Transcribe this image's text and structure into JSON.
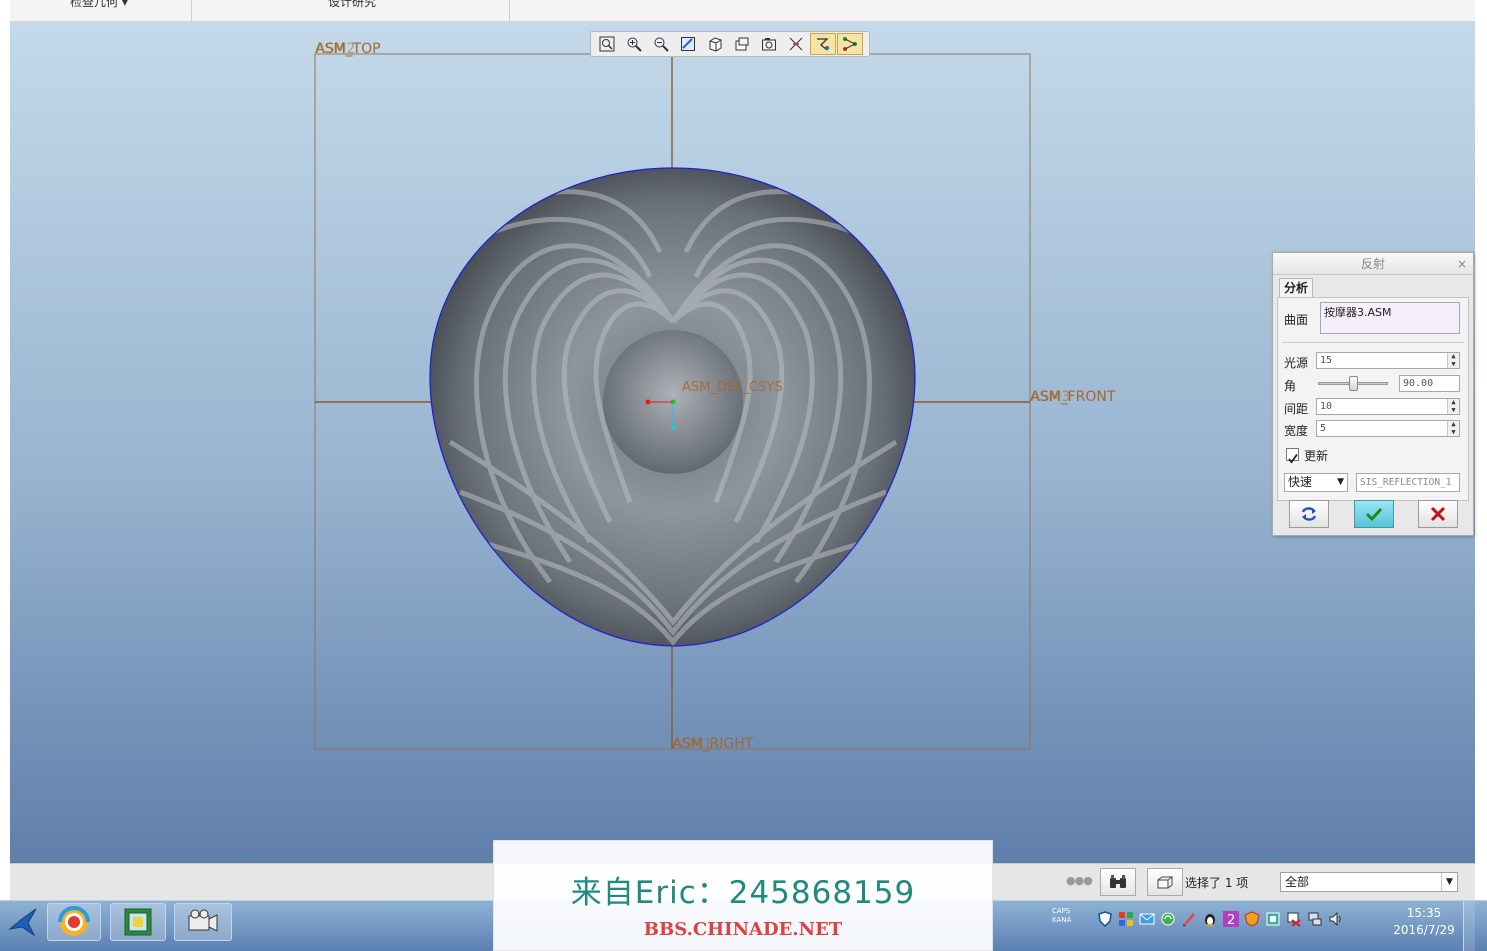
{
  "window": {
    "top_tabs": [
      {
        "label": "检查几何 ▾"
      },
      {
        "label": "设计研究"
      }
    ]
  },
  "datums": {
    "asm_top": "ASM_TOP",
    "asm_top_prefix": "ASM2",
    "asm_front": "ASM_FRONT",
    "asm_front_prefix": "ASM3",
    "asm_right": "ASM_RIGHT",
    "asm_right_prefix": "ASM1",
    "asm_def_csys": "ASM_DEF_CSYS"
  },
  "view_toolbar": {
    "buttons": [
      {
        "icon": "zoom-fit-icon",
        "active": false
      },
      {
        "icon": "zoom-in-icon",
        "active": false
      },
      {
        "icon": "zoom-out-icon",
        "active": false
      },
      {
        "icon": "repaint-icon",
        "active": false
      },
      {
        "icon": "display-style-icon",
        "active": false
      },
      {
        "icon": "saved-views-icon",
        "active": false
      },
      {
        "icon": "view-manager-icon",
        "active": false
      },
      {
        "icon": "datum-display-icon",
        "active": false
      },
      {
        "icon": "spin-center-icon",
        "active": true
      },
      {
        "icon": "annotation-display-icon",
        "active": true
      }
    ]
  },
  "reflection_panel": {
    "title": "反射",
    "close": "×",
    "tab": "分析",
    "surface_label": "曲面",
    "surface_value": "按摩器3.ASM",
    "light_source_label": "光源",
    "light_source_value": "15",
    "angle_label": "角",
    "angle_value": "90.00",
    "angle_slider_fraction": 0.5,
    "spacing_label": "间距",
    "spacing_value": "10",
    "width_label": "宽度",
    "width_value": "5",
    "update_label": "更新",
    "update_checked": true,
    "mode_value": "快速",
    "name_value": "SIS_REFLECTION_1"
  },
  "status_bar": {
    "selection_text": "选择了 1 项",
    "filter_value": "全部"
  },
  "taskbar": {
    "tray_caps": "CAPS",
    "tray_kana": "KANA",
    "time": "15:35",
    "date": "2016/7/29"
  },
  "watermark": {
    "line1": "来自Eric：245868159",
    "line2": "BBS.CHINADE.NET"
  },
  "colors": {
    "datum": "#a5672b",
    "selection_edge": "#2222cc",
    "viewport_top": "#c4daea",
    "viewport_bottom": "#5f7fab"
  }
}
